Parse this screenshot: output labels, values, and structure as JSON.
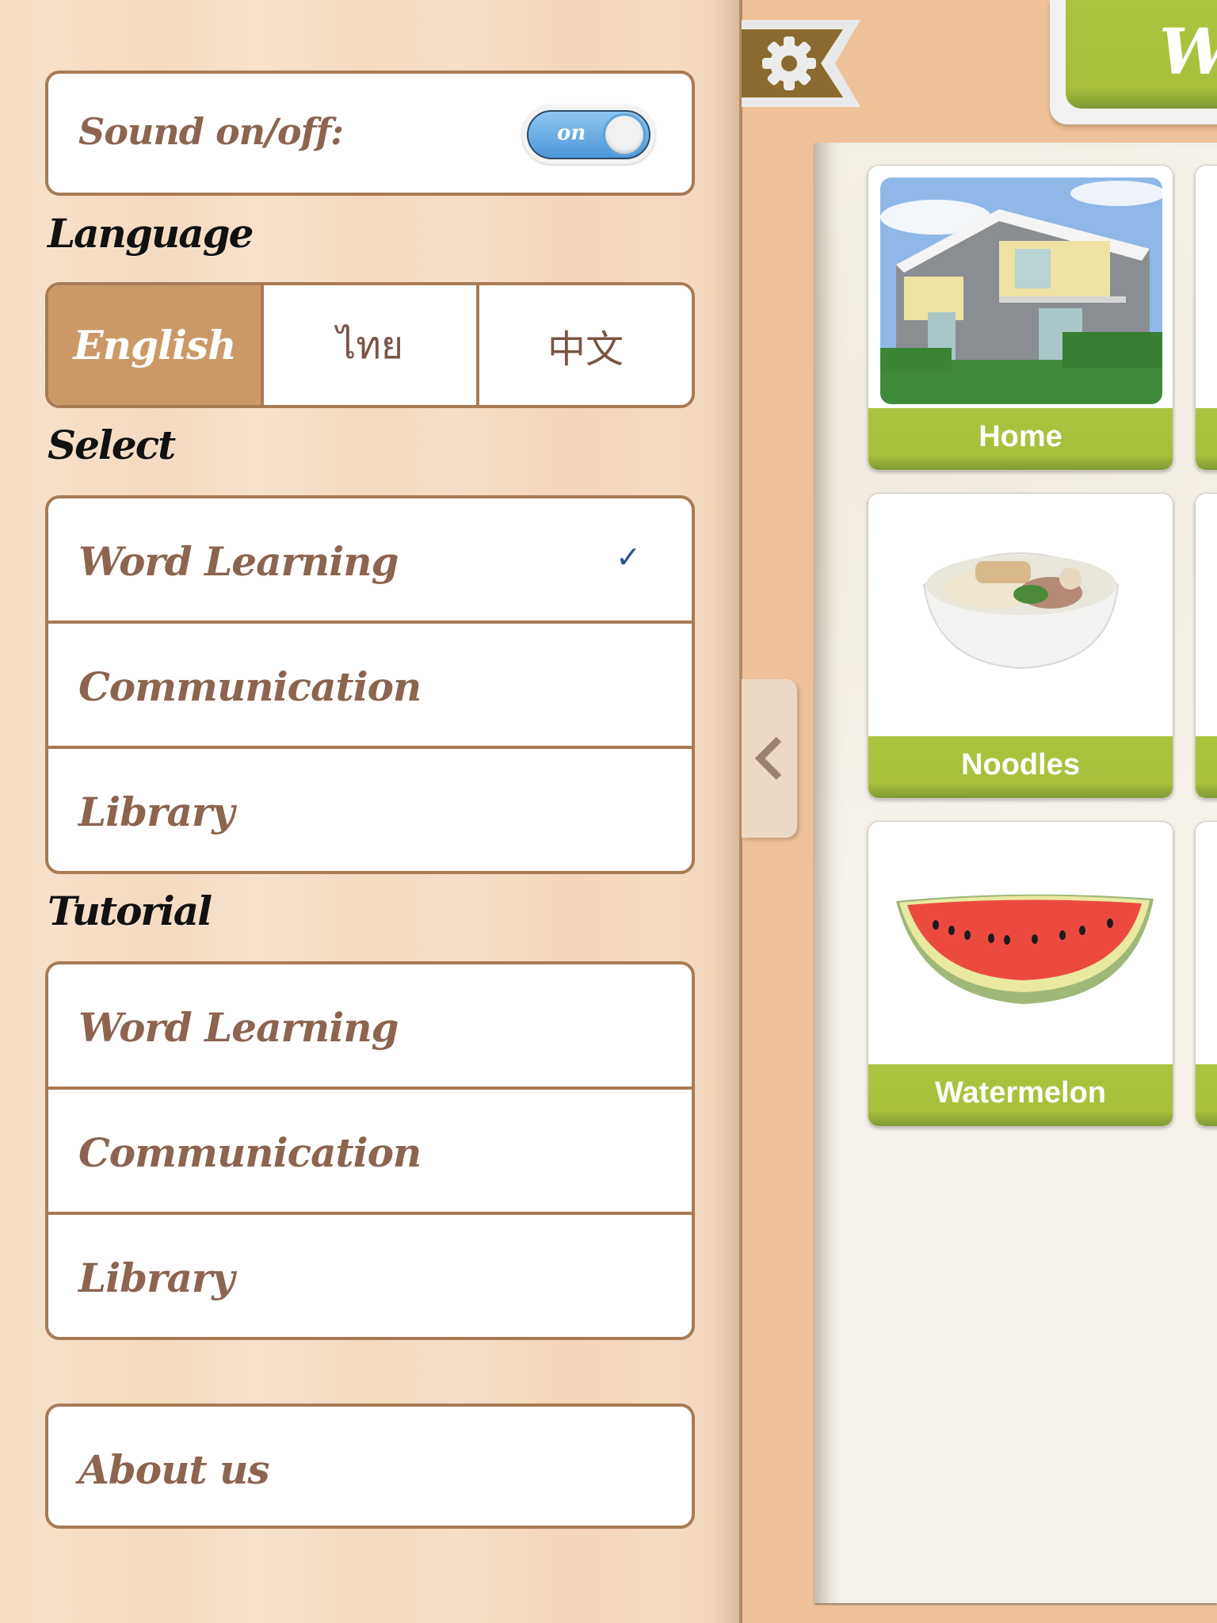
{
  "settings": {
    "sound_label": "Sound on/off:",
    "sound_toggle": {
      "state": "on",
      "label": "on"
    },
    "language_heading": "Language",
    "languages": [
      {
        "label": "English",
        "selected": true
      },
      {
        "label": "ไทย",
        "selected": false
      },
      {
        "label": "中文",
        "selected": false
      }
    ],
    "select_heading": "Select",
    "select_items": [
      {
        "label": "Word Learning",
        "checked": true
      },
      {
        "label": "Communication",
        "checked": false
      },
      {
        "label": "Library",
        "checked": false
      }
    ],
    "check_glyph": "✓",
    "tutorial_heading": "Tutorial",
    "tutorial_items": [
      {
        "label": "Word Learning"
      },
      {
        "label": "Communication"
      },
      {
        "label": "Library"
      }
    ],
    "about_label": "About us"
  },
  "header": {
    "settings_icon": "gear-icon",
    "title_partial": "W"
  },
  "collapse_icon": "chevron-left-icon",
  "cards": [
    {
      "label": "Home",
      "image": "house-photo"
    },
    {
      "label": "Noodles",
      "image": "noodle-bowl-photo"
    },
    {
      "label": "Watermelon",
      "image": "watermelon-photo"
    }
  ],
  "colors": {
    "accent_green": "#a8c03c",
    "panel_border": "#a87b55",
    "selected_language": "#cc9966",
    "item_text": "#8c6450",
    "check": "#2f4f8f",
    "toggle_on": "#4d97d8"
  }
}
